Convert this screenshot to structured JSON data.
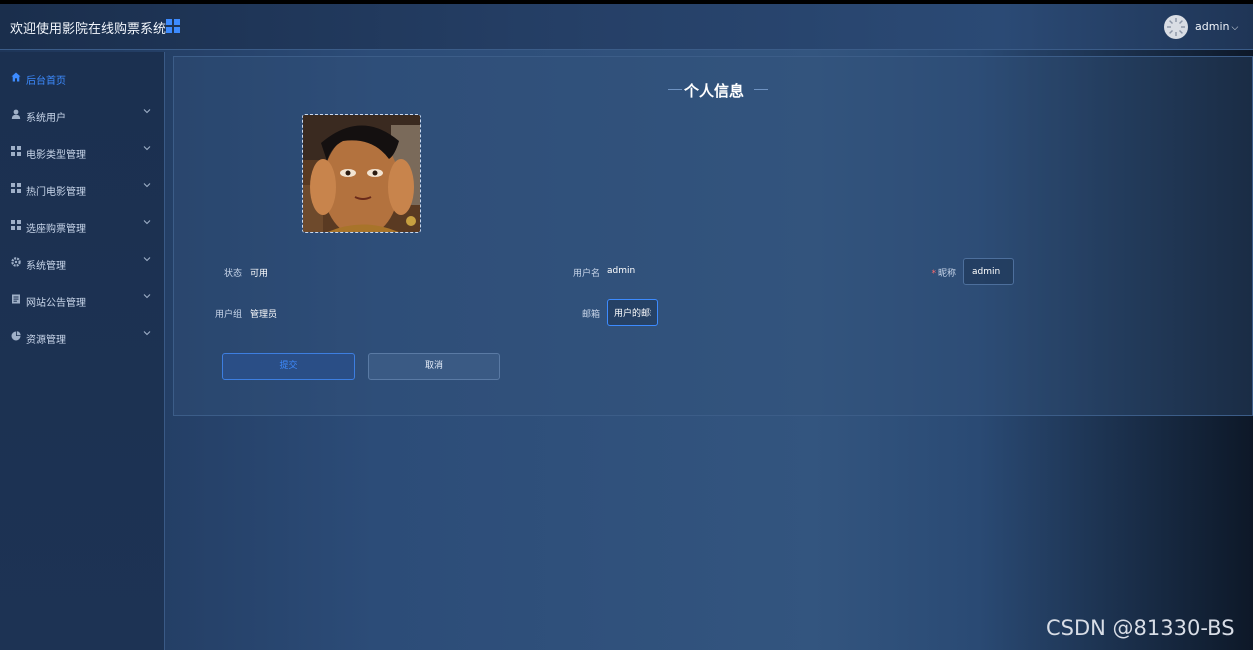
{
  "header": {
    "app_title": "欢迎使用影院在线购票系统",
    "grid_icon": "grid-icon",
    "user_name": "admin",
    "accent": "#3d8bff"
  },
  "sidebar": {
    "items": [
      {
        "label": "后台首页",
        "icon": "home-icon",
        "active": true
      },
      {
        "label": "系统用户",
        "icon": "user-icon"
      },
      {
        "label": "电影类型管理",
        "icon": "grid-icon"
      },
      {
        "label": "热门电影管理",
        "icon": "grid-icon"
      },
      {
        "label": "选座购票管理",
        "icon": "grid-icon"
      },
      {
        "label": "系统管理",
        "icon": "gear-icon"
      },
      {
        "label": "网站公告管理",
        "icon": "document-icon"
      },
      {
        "label": "资源管理",
        "icon": "pie-chart-icon"
      }
    ]
  },
  "main": {
    "page_title": "个人信息",
    "form": {
      "status_label": "状态",
      "status_value": "可用",
      "username_label": "用户名",
      "username_value": "admin",
      "nickname_label": "昵称",
      "nickname_value": "admin",
      "usergroup_label": "用户组",
      "usergroup_value": "管理员",
      "email_label": "邮箱",
      "email_value": "用户的邮箱"
    },
    "buttons": {
      "submit": "提交",
      "cancel": "取消"
    }
  },
  "watermark": "CSDN @81330-BS"
}
